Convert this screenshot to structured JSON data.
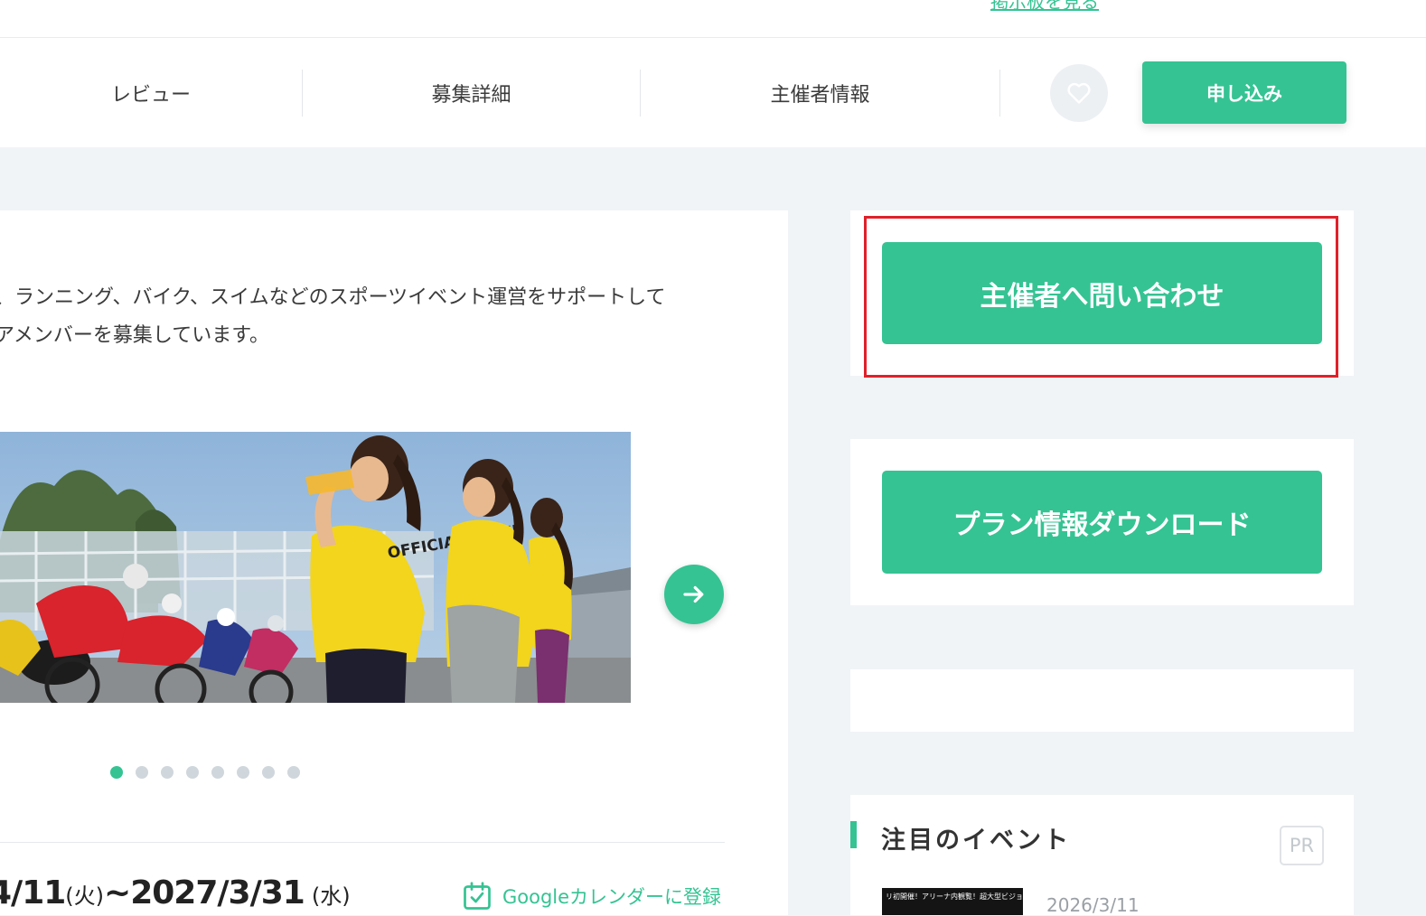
{
  "top": {
    "bbs_link": "掲示板を見る"
  },
  "nav": {
    "tabs": [
      {
        "label": "レビュー"
      },
      {
        "label": "募集詳細"
      },
      {
        "label": "主催者情報"
      }
    ],
    "apply_label": "申し込み"
  },
  "main": {
    "description_lines": [
      "、ランニング、バイク、スイムなどのスポーツイベント運営をサポートして",
      "アメンバーを募集しています。"
    ],
    "photo_shirt_text": "OFFICIAL STAFF",
    "slide_count": 8,
    "active_slide": 1,
    "date": {
      "start": "4/11",
      "start_day": "(火)",
      "sep": "~",
      "end": "2027/3/31",
      "end_day": "(水)"
    },
    "gcal_label": "Googleカレンダーに登録"
  },
  "sidebar": {
    "contact_label": "主催者へ問い合わせ",
    "download_label": "プラン情報ダウンロード",
    "featured_title": "注目のイベント",
    "pr_badge": "PR",
    "featured_item": {
      "thumb_text": "リ初開催！アリーナ内観覧！超大型ビジョンで応",
      "date": "2026/3/11"
    }
  },
  "colors": {
    "accent": "#35c393",
    "highlight": "#e0202a",
    "background": "#f1f4f6"
  }
}
